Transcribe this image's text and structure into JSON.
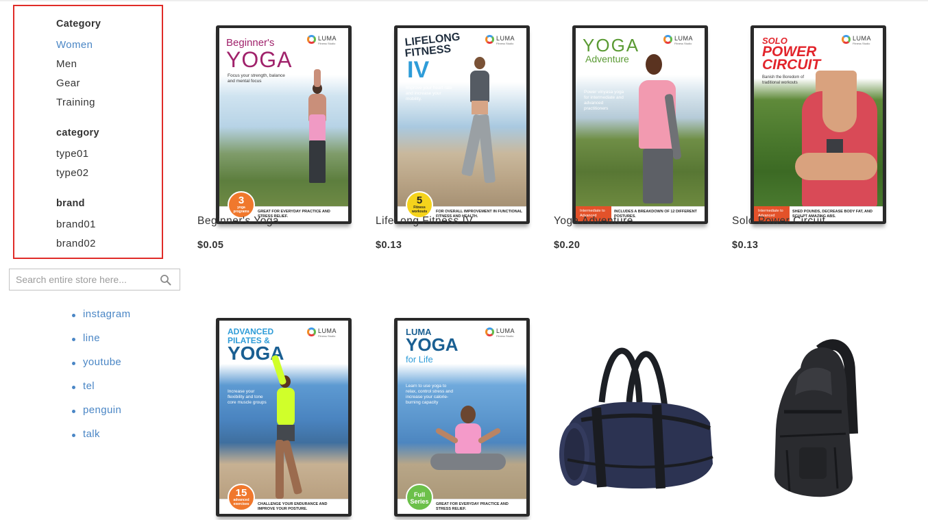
{
  "sidebar": {
    "groups": [
      {
        "title": "Category",
        "items": [
          "Women",
          "Men",
          "Gear",
          "Training"
        ]
      },
      {
        "title": "category",
        "items": [
          "type01",
          "type02"
        ]
      },
      {
        "title": "brand",
        "items": [
          "brand01",
          "brand02"
        ]
      }
    ],
    "search_placeholder": "Search entire store here...",
    "social_links": [
      "instagram",
      "line",
      "youtube",
      "tel",
      "penguin",
      "talk"
    ]
  },
  "colors": {
    "highlight_border": "#e02b27",
    "link": "#4a86c5",
    "text": "#333333"
  },
  "products": [
    {
      "name": "Beginner's Yoga",
      "price": "$0.05",
      "cover": {
        "title_line1": "Beginner's",
        "title_line2": "YOGA",
        "tagline": "Focus your strength, balance and mental focus",
        "badge_number": "3",
        "badge_label": "yoga programs",
        "footer": "GREAT FOR EVERYDAY PRACTICE AND STRESS RELIEF.",
        "brand": "LUMA",
        "brand_sub": "Fitness Studio"
      }
    },
    {
      "name": "LifeLong Fitness IV",
      "price": "$0.13",
      "cover": {
        "title_line1": "LIFELONG",
        "title_line2": "FITNESS",
        "title_line3": "IV",
        "tagline": "Improve your heart rate and increase your mobility.",
        "badge_number": "5",
        "badge_label": "Fitness workouts",
        "footer": "FOR OVERALL IMPROVEMENT IN FUNCTIONAL FITNESS AND HEALTH.",
        "brand": "LUMA",
        "brand_sub": "Fitness Studio"
      }
    },
    {
      "name": "Yoga Adventure",
      "price": "$0.20",
      "cover": {
        "title_line1": "YOGA",
        "title_line2": "Adventure",
        "tagline": "Power vinyasa yoga for intermediate and advanced practitioners",
        "tag": "Intermediate to Advanced",
        "footer": "INCLUDES A BREAKDOWN OF 12 DIFFERENT POSTURES.",
        "brand": "LUMA",
        "brand_sub": "Fitness Studio"
      }
    },
    {
      "name": "Solo Power Circuit",
      "price": "$0.13",
      "cover": {
        "title_line1": "SOLO",
        "title_line2": "POWER",
        "title_line3": "CIRCUIT",
        "tagline": "Banish the Boredom of traditional workouts",
        "tag": "Intermediate to Advanced",
        "footer": "SHED POUNDS, DECREASE BODY FAT, AND SCULPT AMAZING ABS.",
        "brand": "LUMA",
        "brand_sub": "Fitness Studio"
      }
    },
    {
      "cover": {
        "title_line1": "ADVANCED",
        "title_line2": "PILATES &",
        "title_line3": "YOGA",
        "tagline": "Increase your flexibility and tone core muscle groups",
        "badge_number": "15",
        "badge_label": "advanced exercises",
        "footer": "CHALLENGE YOUR ENDURANCE AND IMPROVE YOUR POSTURE.",
        "brand": "LUMA",
        "brand_sub": "Fitness Studio"
      }
    },
    {
      "cover": {
        "title_line1": "LUMA",
        "title_line2": "YOGA",
        "title_line3": "for Life",
        "tagline": "Learn to use yoga to relax, control stress and increase your calorie-burning capacity",
        "badge_number": "Full",
        "badge_label": "Series",
        "footer": "GREAT FOR EVERYDAY PRACTICE AND STRESS RELIEF.",
        "brand": "LUMA",
        "brand_sub": "Fitness Studio"
      }
    },
    {},
    {}
  ]
}
